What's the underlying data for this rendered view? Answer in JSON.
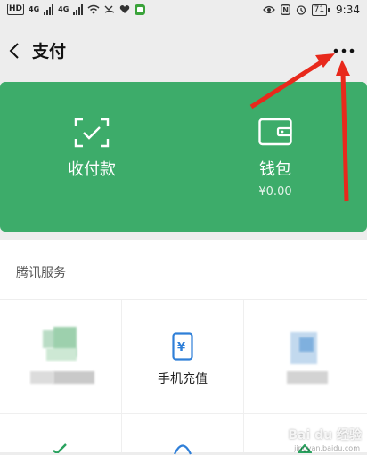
{
  "status_bar": {
    "hd_tag": "HD",
    "signal_1": "4G",
    "signal_2": "4G",
    "battery": "71",
    "time": "9:34"
  },
  "nav": {
    "title": "支付"
  },
  "pay_card": {
    "receive_label": "收付款",
    "wallet_label": "钱包",
    "wallet_balance": "¥0.00",
    "card_color": "#3dac6a"
  },
  "services": {
    "heading": "腾讯服务",
    "items": [
      {
        "label": ""
      },
      {
        "label": "手机充值"
      },
      {
        "label": ""
      }
    ]
  },
  "watermark": {
    "text": "Bai du 经验",
    "url": "jingyan.baidu.com"
  },
  "annotation_color": "#e8291c"
}
